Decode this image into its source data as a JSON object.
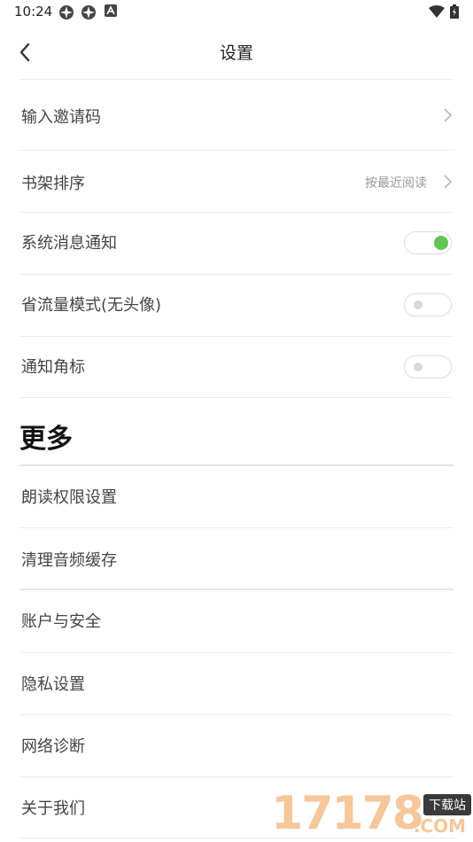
{
  "status_bar": {
    "time": "10:24"
  },
  "header": {
    "title": "设置"
  },
  "settings": {
    "invite_code": {
      "label": "输入邀请码"
    },
    "bookshelf_sort": {
      "label": "书架排序",
      "value": "按最近阅读"
    },
    "system_notify": {
      "label": "系统消息通知",
      "enabled": true
    },
    "data_saver": {
      "label": "省流量模式(无头像)",
      "enabled": false
    },
    "badge": {
      "label": "通知角标",
      "enabled": false
    }
  },
  "more": {
    "title": "更多",
    "items": [
      {
        "label": "朗读权限设置"
      },
      {
        "label": "清理音频缓存"
      },
      {
        "label": "账户与安全"
      },
      {
        "label": "隐私设置"
      },
      {
        "label": "网络诊断"
      },
      {
        "label": "关于我们"
      }
    ]
  },
  "watermark": {
    "digits": "17178",
    "badge": "下载站",
    "suffix": ".COM"
  },
  "colors": {
    "toggle_on": "#5ec651",
    "divider": "#ececec"
  }
}
